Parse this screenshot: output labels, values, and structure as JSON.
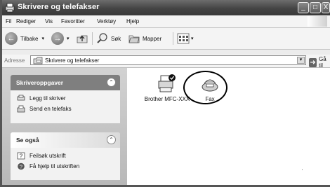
{
  "window": {
    "title": "Skrivere og telefakser",
    "controls": [
      "_",
      "□",
      "X"
    ]
  },
  "menu": [
    "Fil",
    "Rediger",
    "Vis",
    "Favoritter",
    "Verktøy",
    "Hjelp"
  ],
  "toolbar": {
    "back_label": "Tilbake",
    "search_label": "Søk",
    "folders_label": "Mapper"
  },
  "address": {
    "label": "Adresse",
    "value": "Skrivere og telefakser",
    "go_label": "Gå til"
  },
  "tasks_panel": {
    "title": "Skriveroppgaver",
    "items": [
      "Legg til skriver",
      "Send en telefaks"
    ]
  },
  "see_also_panel": {
    "title": "Se også",
    "items": [
      "Feilsøk utskrift",
      "Få hjelp til utskriften"
    ]
  },
  "printers": [
    {
      "name": "Brother MFC-XXX",
      "icon": "printer-default-icon"
    },
    {
      "name": "Fax",
      "icon": "fax-icon"
    }
  ],
  "highlight": {
    "target": "Fax",
    "shape": "ellipse",
    "color": "#000000"
  }
}
